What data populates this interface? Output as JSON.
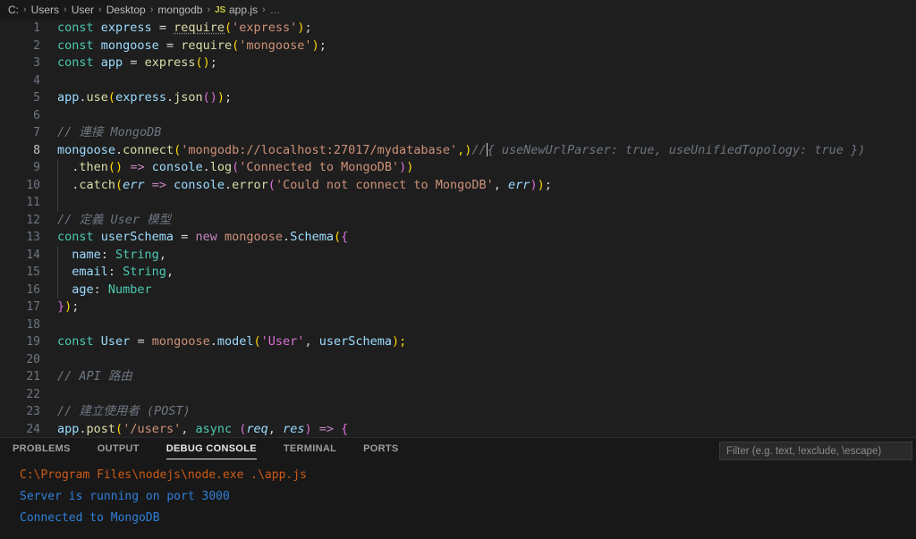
{
  "breadcrumb": {
    "name": "breadcrumb",
    "separator": "›",
    "segments": [
      "C:",
      "Users",
      "User",
      "Desktop",
      "mongodb"
    ],
    "file_icon": "JS",
    "file_name": "app.js",
    "overflow": "…"
  },
  "editor": {
    "active_line": 8,
    "lines": [
      {
        "n": "1",
        "text": "const express = require('express');"
      },
      {
        "n": "2",
        "text": "const mongoose = require('mongoose');"
      },
      {
        "n": "3",
        "text": "const app = express();"
      },
      {
        "n": "4",
        "text": ""
      },
      {
        "n": "5",
        "text": "app.use(express.json());"
      },
      {
        "n": "6",
        "text": ""
      },
      {
        "n": "7",
        "text": "// 連接 MongoDB"
      },
      {
        "n": "8",
        "text": "mongoose.connect('mongodb://localhost:27017/mydatabase',)// { useNewUrlParser: true, useUnifiedTopology: true })"
      },
      {
        "n": "9",
        "text": "  .then(() => console.log('Connected to MongoDB'))"
      },
      {
        "n": "10",
        "text": "  .catch(err => console.error('Could not connect to MongoDB', err));"
      },
      {
        "n": "11",
        "text": ""
      },
      {
        "n": "12",
        "text": "// 定義 User 模型"
      },
      {
        "n": "13",
        "text": "const userSchema = new mongoose.Schema({"
      },
      {
        "n": "14",
        "text": "  name: String,"
      },
      {
        "n": "15",
        "text": "  email: String,"
      },
      {
        "n": "16",
        "text": "  age: Number"
      },
      {
        "n": "17",
        "text": "});"
      },
      {
        "n": "18",
        "text": ""
      },
      {
        "n": "19",
        "text": "const User = mongoose.model('User', userSchema);"
      },
      {
        "n": "20",
        "text": ""
      },
      {
        "n": "21",
        "text": "// API 路由"
      },
      {
        "n": "22",
        "text": ""
      },
      {
        "n": "23",
        "text": "// 建立使用者 (POST)"
      },
      {
        "n": "24",
        "text": "app.post('/users', async (req, res) => {"
      }
    ],
    "ghost_suggestion": "{ useNewUrlParser: true, useUnifiedTopology: true })"
  },
  "panel": {
    "tabs": [
      {
        "label": "PROBLEMS",
        "active": false
      },
      {
        "label": "OUTPUT",
        "active": false
      },
      {
        "label": "DEBUG CONSOLE",
        "active": true
      },
      {
        "label": "TERMINAL",
        "active": false
      },
      {
        "label": "PORTS",
        "active": false
      }
    ],
    "filter_placeholder": "Filter (e.g. text, !exclude, \\escape)",
    "console_lines": [
      {
        "text": "C:\\Program Files\\nodejs\\node.exe .\\app.js",
        "kind": "command"
      },
      {
        "text": "Server is running on port 3000",
        "kind": "output"
      },
      {
        "text": "Connected to MongoDB",
        "kind": "output"
      }
    ]
  },
  "colors": {
    "editor_background": "#1e1e1e",
    "panel_background": "#181818",
    "line_number": "#6e7681",
    "active_line_number": "#c6c6c6",
    "comment": "#6e7681",
    "string": "#ce9178",
    "keyword": "#569cd6",
    "console_command": "#cd5a17",
    "console_output": "#2f7fd8",
    "js_icon": "#cbcb41"
  }
}
